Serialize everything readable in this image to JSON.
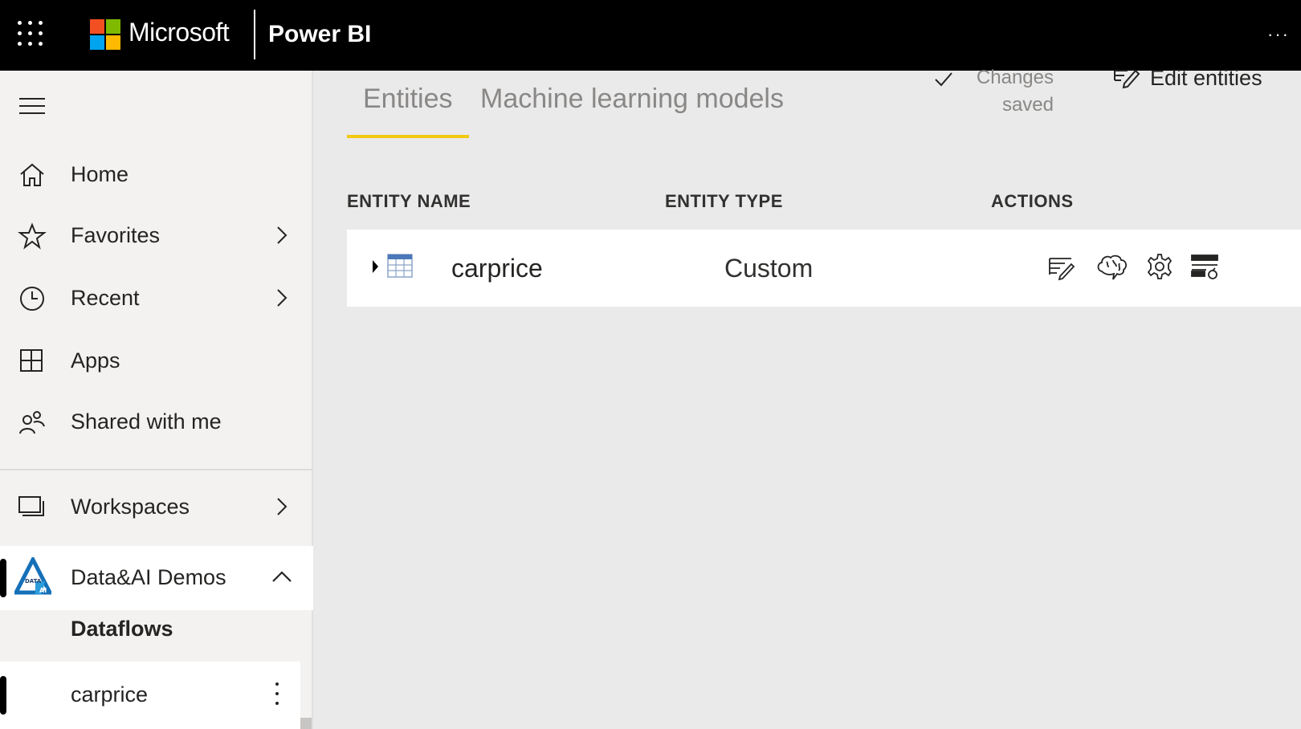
{
  "header": {
    "brand": "Microsoft",
    "product": "Power BI",
    "brand_colors": [
      "#f25022",
      "#7fba00",
      "#00a4ef",
      "#ffb900"
    ]
  },
  "sidebar": {
    "items": [
      {
        "label": "Home",
        "icon": "home-icon"
      },
      {
        "label": "Favorites",
        "icon": "star-icon"
      },
      {
        "label": "Recent",
        "icon": "clock-icon"
      },
      {
        "label": "Apps",
        "icon": "apps-icon"
      },
      {
        "label": "Shared with me",
        "icon": "shared-icon"
      },
      {
        "label": "Workspaces",
        "icon": "workspaces-icon"
      }
    ],
    "workspace": {
      "label": "Data&AI Demos",
      "logo_text": "DATA AI"
    },
    "section": "Dataflows",
    "dataflow": "carprice"
  },
  "main": {
    "tabs": [
      {
        "label": "Entities",
        "active": true
      },
      {
        "label": "Machine learning models",
        "active": false
      }
    ],
    "status": "Changes saved",
    "edit_label": "Edit entities",
    "columns": [
      "ENTITY NAME",
      "ENTITY TYPE",
      "ACTIONS"
    ],
    "rows": [
      {
        "name": "carprice",
        "type": "Custom",
        "actions": [
          "edit-entity-icon",
          "ai-insights-icon",
          "settings-icon",
          "incremental-refresh-icon"
        ]
      }
    ],
    "accent": "#f2c811"
  }
}
